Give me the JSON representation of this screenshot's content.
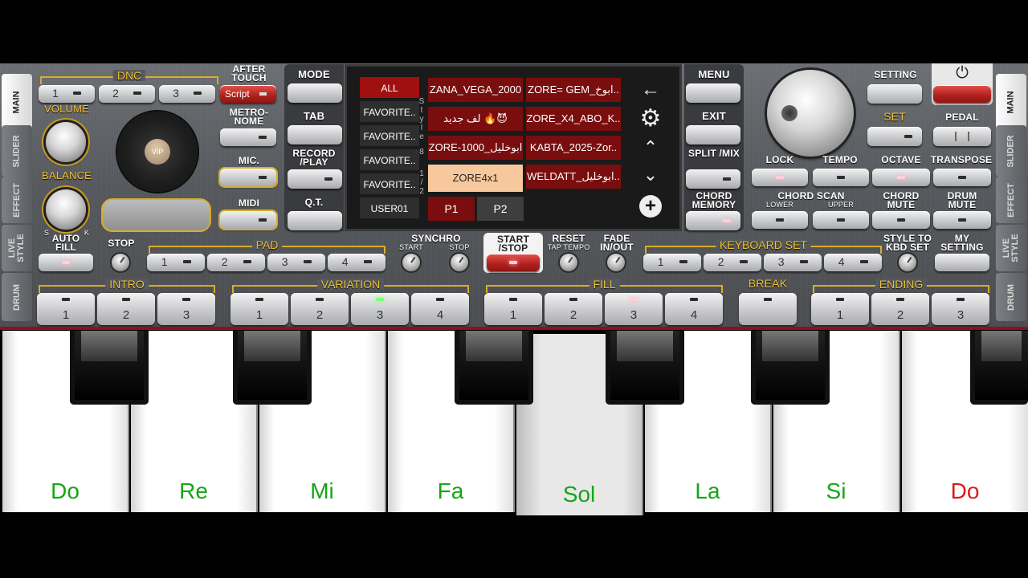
{
  "side_tabs": {
    "main": "MAIN",
    "slider": "SLIDER",
    "effect": "EFFECT",
    "live_style": "LIVE STYLE",
    "drum": "DRUM"
  },
  "dnc": {
    "label": "DNC",
    "buttons": [
      "1",
      "2",
      "3"
    ]
  },
  "after_touch": {
    "label": "AFTER TOUCH",
    "button": "Script"
  },
  "volume": "VOLUME",
  "balance": "BALANCE",
  "balance_s": "S",
  "balance_k": "K",
  "auto_fill": "AUTO FILL",
  "metronome": "METRO- NOME",
  "mic": "MIC.",
  "midi": "MIDI",
  "vip": "VIP",
  "left_nav": {
    "mode": "MODE",
    "tab": "TAB",
    "record": "RECORD /PLAY",
    "qt": "Q.T."
  },
  "screen": {
    "categories": [
      "ALL",
      "FAVORITE..",
      "FAVORITE..",
      "FAVORITE..",
      "FAVORITE..",
      "USER01"
    ],
    "vertical_label": [
      "S",
      "t",
      "y",
      "l",
      "e",
      "8",
      "1",
      "/",
      "2"
    ],
    "styles": [
      [
        "ZANA_VEGA_2000",
        "ZORE= GEM_ابوخ.."
      ],
      [
        "لف جديد 🔥😈",
        "ZORE_X4_ABO_K.."
      ],
      [
        "ZORE-1000_ابوخليل",
        "KABTA_2025-Zor.."
      ],
      [
        "ZORE4x1",
        "WELDATT_ابوخليل.."
      ]
    ],
    "selected_style": "ZORE4x1",
    "pages": [
      "P1",
      "P2"
    ]
  },
  "right_nav": {
    "menu": "MENU",
    "exit": "EXIT",
    "split": "SPLIT /MIX",
    "chord_memory": "CHORD MEMORY"
  },
  "setting": "SETTING",
  "set": "SET",
  "pedal": "PEDAL",
  "lock": "LOCK",
  "tempo": "TEMPO",
  "octave": "OCTAVE",
  "transpose": "TRANSPOSE",
  "chord_scan": {
    "label": "CHORD SCAN",
    "lower": "LOWER",
    "upper": "UPPER"
  },
  "chord_mute": "CHORD MUTE",
  "drum_mute": "DRUM MUTE",
  "stop": "STOP",
  "pad": {
    "label": "PAD",
    "buttons": [
      "1",
      "2",
      "3",
      "4"
    ]
  },
  "synchro": {
    "label": "SYNCHRO",
    "start": "START",
    "stop": "STOP"
  },
  "start_stop": "START /STOP",
  "reset": "RESET",
  "tap_tempo": "TAP TEMPO",
  "fade": "FADE IN/OUT",
  "keyboard_set": {
    "label": "KEYBOARD SET",
    "buttons": [
      "1",
      "2",
      "3",
      "4"
    ]
  },
  "style_to_kbd": "STYLE TO KBD SET",
  "my_setting": "MY SETTING",
  "intro": {
    "label": "INTRO",
    "buttons": [
      "1",
      "2",
      "3"
    ]
  },
  "variation": {
    "label": "VARIATION",
    "buttons": [
      "1",
      "2",
      "3",
      "4"
    ],
    "active": "3"
  },
  "fill": {
    "label": "FILL",
    "buttons": [
      "1",
      "2",
      "3",
      "4"
    ],
    "active": "3"
  },
  "break": "BREAK",
  "ending": {
    "label": "ENDING",
    "buttons": [
      "1",
      "2",
      "3"
    ]
  },
  "keys": [
    "Do",
    "Re",
    "Mi",
    "Fa",
    "Sol",
    "La",
    "Si",
    "Do"
  ],
  "colors": {
    "accent_yellow": "#f1c232",
    "style_red": "#7a0e0e",
    "selected_style": "#f6c89b",
    "note_green": "#14a614",
    "note_red": "#e01818"
  }
}
